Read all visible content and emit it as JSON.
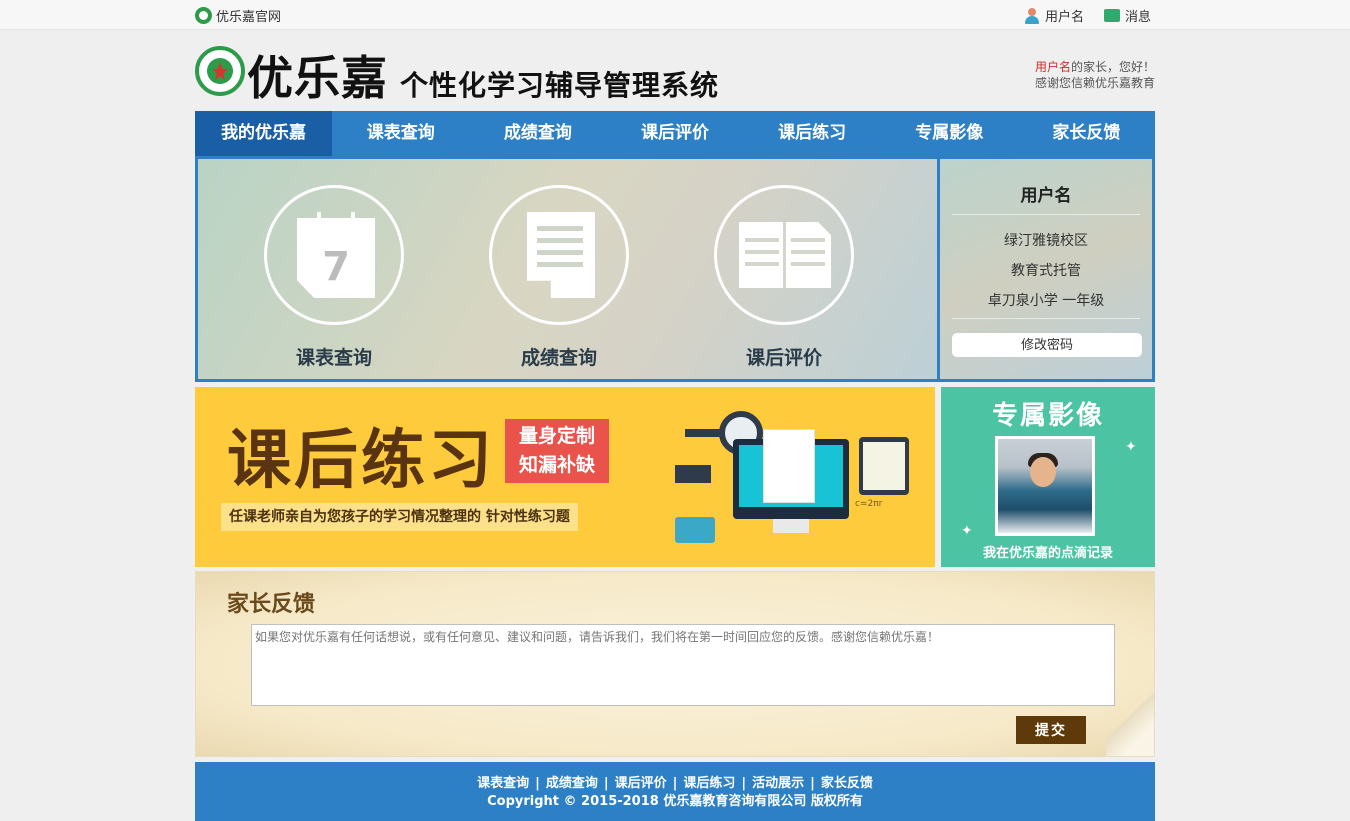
{
  "topbar": {
    "home_label": "优乐嘉官网",
    "user_label": "用户名",
    "message_label": "消息"
  },
  "header": {
    "brand": "优乐嘉",
    "brand_subtitle": "个性化学习辅导管理系统",
    "greeting_user": "用户名",
    "greeting_suffix": "的家长，您好！",
    "greeting_thanks": "感谢您信赖优乐嘉教育"
  },
  "nav": {
    "items": [
      "我的优乐嘉",
      "课表查询",
      "成绩查询",
      "课后评价",
      "课后练习",
      "专属影像",
      "家长反馈"
    ],
    "active_index": 0
  },
  "quick_links": [
    {
      "label": "课表查询",
      "icon": "calendar-icon",
      "calendar_number": "7"
    },
    {
      "label": "成绩查询",
      "icon": "document-icon"
    },
    {
      "label": "课后评价",
      "icon": "book-icon"
    }
  ],
  "profile": {
    "name": "用户名",
    "campus": "绿汀雅镜校区",
    "program": "教育式托管",
    "school": "卓刀泉小学 一年级",
    "change_password": "修改密码"
  },
  "banner": {
    "title": "课后练习",
    "tag_line1": "量身定制",
    "tag_line2": "知漏补缺",
    "subtitle": "任课老师亲自为您孩子的学习情况整理的 针对性练习题",
    "formula": "c=2πr"
  },
  "video": {
    "title": "专属影像",
    "caption": "我在优乐嘉的点滴记录"
  },
  "feedback": {
    "title": "家长反馈",
    "placeholder": "如果您对优乐嘉有任何话想说，或有任何意见、建议和问题，请告诉我们，我们将在第一时间回应您的反馈。感谢您信赖优乐嘉！",
    "submit": "提交"
  },
  "footer": {
    "links": [
      "课表查询",
      "成绩查询",
      "课后评价",
      "课后练习",
      "活动展示",
      "家长反馈"
    ],
    "copyright": "Copyright © 2015-2018 优乐嘉教育咨询有限公司 版权所有"
  },
  "colors": {
    "primary_blue": "#2d80c5",
    "nav_active": "#1a5fa6",
    "banner_yellow": "#fdcb3c",
    "video_green": "#4cc4a3",
    "submit_brown": "#5e3a0a",
    "greeting_red": "#d32a2a"
  }
}
